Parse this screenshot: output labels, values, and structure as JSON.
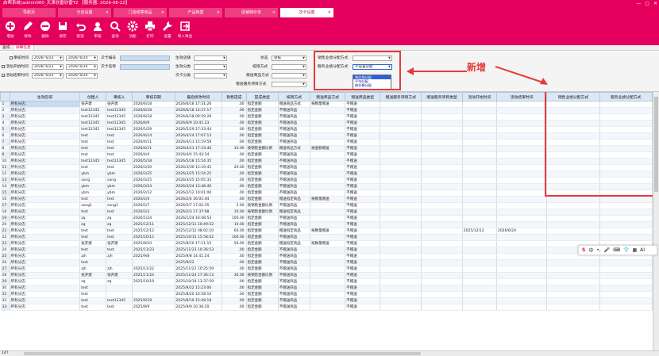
{
  "window": {
    "title": "启帮系统(admin000_天津欣雷欣雷T2    【服务器: 2026-06-22】",
    "minimize": "—",
    "maximize": "▢",
    "close": "✕"
  },
  "tabs": [
    {
      "label": "导航页"
    },
    {
      "label": "分店设置"
    },
    {
      "label": "门店结算商品"
    },
    {
      "label": "产品档案"
    },
    {
      "label": "促销特价单"
    },
    {
      "label": "次卡设置"
    }
  ],
  "toolbar": [
    {
      "label": "增加",
      "icon": "plus-icon"
    },
    {
      "label": "修改",
      "icon": "pencil-icon"
    },
    {
      "label": "删除",
      "icon": "minus-icon"
    },
    {
      "label": "保存",
      "icon": "save-icon"
    },
    {
      "label": "取消",
      "icon": "undo-icon"
    },
    {
      "label": "审核",
      "icon": "user-check-icon"
    },
    {
      "label": "查询",
      "icon": "search-icon"
    },
    {
      "label": "功能",
      "icon": "gear-icon"
    },
    {
      "label": "打印",
      "icon": "printer-icon"
    },
    {
      "label": "设置",
      "icon": "wrench-icon"
    },
    {
      "label": "导入导出",
      "icon": "import-export-icon"
    }
  ],
  "subtabs": [
    {
      "label": "查询"
    },
    {
      "label": "详细信息"
    }
  ],
  "filters": {
    "audit_time": "审核时间",
    "created_time": "活动开始时间",
    "end_time": "活动结束时间",
    "date_from": "2026/ 6/23",
    "date_to": "2026/ 6/24",
    "card_no": "次卡编号",
    "card_name": "次卡名称",
    "valid_store": "生效店铺",
    "valid_category": "生效分类",
    "card_category": "次卡分类",
    "status": "状态",
    "status_value": "审核",
    "deduct_method": "核销方式",
    "valid_goods_method": "赠送商品方式",
    "service_project_method": "赠送服务项目方式",
    "sales_perf": "销售业绩分配方式",
    "service_perf": "服务业绩分配方式",
    "service_perf_value": "不设置分配"
  },
  "dropdown_options": [
    "按比例分配",
    "平均分配",
    "按价格分配"
  ],
  "annotation": "新增",
  "columns": [
    "生效区域",
    "创建人",
    "审核人",
    "审核日期",
    "最后修改时间",
    "销售提成",
    "提成类型",
    "核销方式",
    "赠送商品方式",
    "赠送商品类型",
    "赠送服务项目方式",
    "赠送服务项目类型",
    "活动开始时间",
    "活动结束时间",
    "销售业绩分配方式",
    "服务业绩分配方式"
  ],
  "rows": [
    [
      "所有分店;",
      "张开建",
      "张开建",
      "2026/6/18",
      "2026/6/18 17:31:26",
      ".00",
      "指定金额",
      "赠送商品方式",
      "按数量赠送",
      "不赠送",
      "",
      "",
      "",
      "",
      "",
      ""
    ],
    [
      "所有分店;",
      "test12345",
      "test12345",
      "2026/6/18",
      "2026/6/18 14:27:17",
      ".00",
      "指定金额",
      "不赠送商品",
      "",
      "不赠送",
      "",
      "",
      "",
      "",
      "",
      ""
    ],
    [
      "所有分店;",
      "test12345",
      "test12345",
      "2026/6/18",
      "2026/6/18 09:59:29",
      ".00",
      "指定金额",
      "不赠送商品",
      "",
      "不赠送",
      "",
      "",
      "",
      "",
      "",
      ""
    ],
    [
      "所有分店;",
      "test12345",
      "test12345",
      "2026/6/9",
      "2026/6/9 10:41:23",
      ".00",
      "指定金额",
      "不赠送商品",
      "",
      "不赠送",
      "",
      "",
      "",
      "",
      "",
      ""
    ],
    [
      "所有分店;",
      "test12345",
      "test12345",
      "2026/5/29",
      "2026/5/29 17:33:44",
      ".00",
      "指定金额",
      "不赠送商品",
      "",
      "不赠送",
      "",
      "",
      "",
      "",
      "",
      ""
    ],
    [
      "所有分店;",
      "test",
      "test",
      "2026/4/14",
      "2026/4/14 17:07:13",
      ".00",
      "指定金额",
      "不赠送商品",
      "",
      "不赠送",
      "",
      "",
      "",
      "",
      "",
      ""
    ],
    [
      "所有分店;",
      "test",
      "test",
      "2026/4/11",
      "2026/4/11 15:19:59",
      ".00",
      "指定金额",
      "不赠送商品",
      "",
      "不赠送",
      "",
      "",
      "",
      "",
      "",
      ""
    ],
    [
      "所有分店;",
      "test",
      "test",
      "2026/4/11",
      "2026/4/11 17:33:40",
      "10.00",
      "按销售金额比例",
      "赠送商品方式",
      "按金额赠送",
      "不赠送",
      "",
      "",
      "",
      "",
      "",
      ""
    ],
    [
      "所有分店;",
      "test",
      "test",
      "2026/4/4",
      "2026/4/4 15:43:34",
      ".00",
      "指定金额",
      "不赠送商品",
      "",
      "不赠送",
      "",
      "",
      "",
      "",
      "",
      ""
    ],
    [
      "所有分店;",
      "test12345",
      "test12345",
      "2026/5/18",
      "2026/5/18 15:54:35",
      ".00",
      "指定金额",
      "不赠送商品",
      "",
      "不赠送",
      "",
      "",
      "",
      "",
      "",
      ""
    ],
    [
      "所有分店;",
      "test",
      "test",
      "2026/3/30",
      "2026/3/30 15:19:45",
      "20.00",
      "指定金额",
      "不赠送商品",
      "",
      "不赠送",
      "",
      "",
      "",
      "",
      "",
      ""
    ],
    [
      "所有分店;",
      "ybm",
      "ybm",
      "2026/3/25",
      "2026/3/25 15:54:25",
      ".00",
      "指定金额",
      "不赠送商品",
      "",
      "不赠送",
      "",
      "",
      "",
      "",
      "",
      ""
    ],
    [
      "所有分店;",
      "song",
      "song",
      "2026/3/25",
      "2026/3/25 15:05:33",
      ".00",
      "指定金额",
      "不赠送商品",
      "",
      "不赠送",
      "",
      "",
      "",
      "",
      "",
      ""
    ],
    [
      "所有分店;",
      "ybm",
      "ybm",
      "2026/3/24",
      "2026/3/24 13:48:40",
      ".00",
      "指定金额",
      "不赠送商品",
      "",
      "不赠送",
      "",
      "",
      "",
      "",
      "",
      ""
    ],
    [
      "所有分店;",
      "ybm",
      "ybm",
      "2026/2/12",
      "2026/2/12 10:01:00",
      ".00",
      "指定金额",
      "不赠送商品",
      "",
      "不赠送",
      "",
      "",
      "",
      "",
      "",
      ""
    ],
    [
      "所有分店;",
      "test",
      "test",
      "2026/2/4",
      "2026/2/4 16:01:44",
      ".00",
      "指定金额",
      "赠送指定商品",
      "按数量赠送",
      "不赠送",
      "",
      "",
      "",
      "",
      "",
      ""
    ],
    [
      "所有分店;",
      "song1",
      "song1",
      "2026/5/7",
      "2026/5/7 17:02:35",
      "5.00",
      "按销售金额比例",
      "不赠送商品",
      "",
      "不赠送",
      "",
      "",
      "",
      "",
      "",
      ""
    ],
    [
      "所有分店;",
      "test",
      "test",
      "2026/2/3",
      "2026/2/3 17:37:08",
      "10.00",
      "按销售金额比例",
      "赠送指定商品",
      "",
      "不赠送",
      "",
      "",
      "",
      "",
      "",
      ""
    ],
    [
      "所有分店;",
      "zq",
      "zq",
      "2026/1/24",
      "2026/1/24 16:48:53",
      "100.00",
      "指定金额",
      "不赠送商品",
      "",
      "不赠送",
      "",
      "",
      "",
      "",
      "",
      ""
    ],
    [
      "所有分店;",
      "zq",
      "zq",
      "2025/12/11",
      "2025/12/11 10:49:52",
      "10.00",
      "指定金额",
      "不赠送商品",
      "",
      "不赠送",
      "",
      "",
      "",
      "",
      "",
      ""
    ],
    [
      "所有分店;",
      "test",
      "test",
      "2025/12/12",
      "2025/12/12 08:02:10",
      "60.00",
      "指定金额",
      "赠送指定商品",
      "按数量赠送",
      "不赠送",
      "",
      "",
      "2025/12/12",
      "2026/6/24",
      "",
      ""
    ],
    [
      "所有分店;",
      "test",
      "test",
      "2025/10/15",
      "2025/10/15 15:58:02",
      "100.00",
      "指定金额",
      "不赠送商品",
      "",
      "不赠送",
      "",
      "",
      "",
      "",
      "",
      ""
    ],
    [
      "所有分店;",
      "张开建",
      "张开建",
      "2025/9/10",
      "2025/9/10 17:11:15",
      "50.00",
      "指定金额",
      "赠送指定商品",
      "按数量赠送",
      "不赠送",
      "",
      "",
      "",
      "",
      "",
      ""
    ],
    [
      "所有分店;",
      "test",
      "test",
      "2025/11/23",
      "2025/11/23 10:36:53",
      ".00",
      "指定金额",
      "不赠送商品",
      "",
      "不赠送",
      "",
      "",
      "",
      "",
      "",
      ""
    ],
    [
      "所有分店;",
      "zjh",
      "zjh",
      "2025/9/8",
      "2025/9/8 14:41:54",
      ".00",
      "指定金额",
      "不赠送商品",
      "",
      "不赠送",
      "",
      "",
      "",
      "",
      "",
      ""
    ],
    [
      "所有分店;",
      "test",
      "",
      "",
      "2025/9/22",
      ".00",
      "指定金额",
      "不赠送商品",
      "",
      "不赠送",
      "",
      "",
      "",
      "",
      "",
      ""
    ],
    [
      "所有分店;",
      "zjh",
      "zjh",
      "2025/11/22",
      "2025/11/22 10:25:59",
      ".00",
      "指定金额",
      "不赠送商品",
      "",
      "不赠送",
      "",
      "",
      "",
      "",
      "",
      ""
    ],
    [
      "所有分店;",
      "张开建",
      "张开建",
      "2025/11/24",
      "2025/11/24 17:36:13",
      "30.00",
      "按销售金额比例",
      "不赠送商品",
      "",
      "不赠送",
      "",
      "",
      "",
      "",
      "",
      ""
    ],
    [
      "所有分店;",
      "zq",
      "zq",
      "2025/10/19",
      "2025/10/19 13:37:59",
      ".00",
      "指定金额",
      "不赠送商品",
      "",
      "不赠送",
      "",
      "",
      "",
      "",
      "",
      ""
    ],
    [
      "所有分店;",
      "test",
      "",
      "",
      "2025/9/22 15:23:06",
      ".00",
      "指定金额",
      "不赠送商品",
      "",
      "不赠送",
      "",
      "",
      "",
      "",
      "",
      ""
    ],
    [
      "所有分店;",
      "test",
      "",
      "",
      "2025/8/20 10:58:10",
      ".00",
      "指定金额",
      "不赠送商品",
      "",
      "不赠送",
      "",
      "",
      "",
      "",
      "",
      ""
    ],
    [
      "所有分店;",
      "test",
      "test12345",
      "2025/9/19",
      "2025/9/19 15:49:18",
      ".00",
      "指定金额",
      "不赠送商品",
      "",
      "不赠送",
      "",
      "",
      "",
      "",
      "",
      ""
    ],
    [
      "所有分店;",
      "test",
      "test",
      "2025/9/9",
      "2025/9/9 10:36:20",
      ".00",
      "指定金额",
      "不赠送商品",
      "",
      "不赠送",
      "",
      "",
      "",
      "",
      "",
      ""
    ]
  ],
  "total_count": "147",
  "ime": {
    "s": "S",
    "zh": "中",
    "dot": "•,",
    "mic": "🎤",
    "kb": "⌨",
    "skin": "👕",
    "grid": "▦",
    "ai": "AI"
  }
}
